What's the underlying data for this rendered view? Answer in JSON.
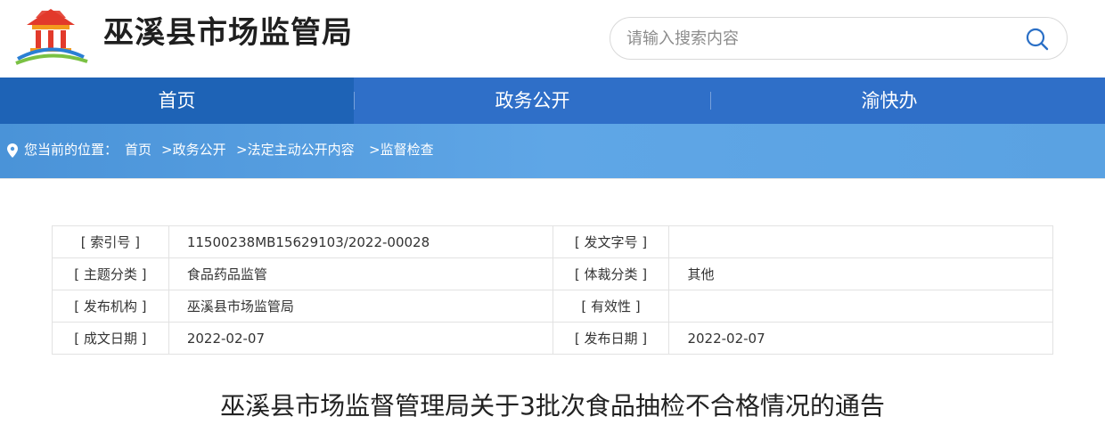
{
  "site": {
    "title": "巫溪县市场监管局"
  },
  "search": {
    "placeholder": "请输入搜索内容"
  },
  "nav": {
    "items": [
      "首页",
      "政务公开",
      "渝快办"
    ]
  },
  "breadcrumb": {
    "prefix": "您当前的位置：",
    "items": [
      "首页",
      ">政务公开",
      ">法定主动公开内容",
      ">监督检查"
    ]
  },
  "meta": {
    "rows": [
      {
        "label1": "[ 索引号 ]",
        "value1": "11500238MB15629103/2022-00028",
        "label2": "[ 发文字号 ]",
        "value2": ""
      },
      {
        "label1": "[ 主题分类 ]",
        "value1": "食品药品监管",
        "label2": "[ 体裁分类 ]",
        "value2": "其他"
      },
      {
        "label1": "[ 发布机构 ]",
        "value1": "巫溪县市场监管局",
        "label2": "[ 有效性 ]",
        "value2": ""
      },
      {
        "label1": "[ 成文日期 ]",
        "value1": "2022-02-07",
        "label2": "[ 发布日期 ]",
        "value2": "2022-02-07"
      }
    ]
  },
  "article": {
    "title": "巫溪县市场监督管理局关于3批次食品抽检不合格情况的通告"
  },
  "colors": {
    "nav": "#2f6fc8",
    "nav_active": "#1e63b6",
    "breadcrumb": "#5aa2e2",
    "logo_red": "#e23a2b",
    "logo_orange": "#f39a1e",
    "logo_blue": "#2a7fd4",
    "logo_green": "#7ac143"
  },
  "icons": {
    "logo": "county-gate-logo",
    "search": "search-icon",
    "pin": "location-pin-icon"
  }
}
